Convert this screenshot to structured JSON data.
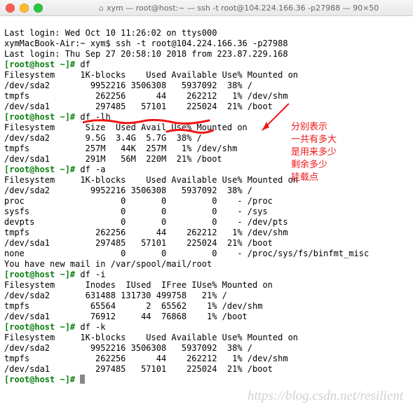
{
  "window": {
    "title": "xym — root@host:~ — ssh -t root@104.224.166.36 -p27988 — 90×50",
    "traffic": [
      "red",
      "yellow",
      "green"
    ],
    "home_icon": "⌂"
  },
  "lines": {
    "l0": "Last login: Wed Oct 10 11:26:02 on ttys000",
    "l1": "xymMacBook-Air:~ xym$ ssh -t root@104.224.166.36 -p27988",
    "l2": "Last login: Thu Sep 27 20:58:10 2018 from 223.87.229.168",
    "l3a": "[root@host ~]# ",
    "l3b": "df",
    "l4": "Filesystem     1K-blocks    Used Available Use% Mounted on",
    "l5": "/dev/sda2        9952216 3506308   5937092  38% /",
    "l6": "tmpfs             262256      44    262212   1% /dev/shm",
    "l7": "/dev/sda1         297485   57101    225024  21% /boot",
    "l8a": "[root@host ~]# ",
    "l8b": "df -lh",
    "l9": "Filesystem      Size  Used Avail Use% Mounted on",
    "l10": "/dev/sda2       9.5G  3.4G  5.7G  38% /",
    "l11": "tmpfs           257M   44K  257M   1% /dev/shm",
    "l12": "/dev/sda1       291M   56M  220M  21% /boot",
    "l13a": "[root@host ~]# ",
    "l13b": "df -a",
    "l14": "Filesystem     1K-blocks    Used Available Use% Mounted on",
    "l15": "/dev/sda2        9952216 3506308   5937092  38% /",
    "l16": "proc                   0       0         0    - /proc",
    "l17": "sysfs                  0       0         0    - /sys",
    "l18": "devpts                 0       0         0    - /dev/pts",
    "l19": "tmpfs             262256      44    262212   1% /dev/shm",
    "l20": "/dev/sda1         297485   57101    225024  21% /boot",
    "l21": "none                   0       0         0    - /proc/sys/fs/binfmt_misc",
    "l22": "You have new mail in /var/spool/mail/root",
    "l23a": "[root@host ~]# ",
    "l23b": "df -i",
    "l24": "Filesystem      Inodes  IUsed  IFree IUse% Mounted on",
    "l25": "/dev/sda2       631488 131730 499758   21% /",
    "l26": "tmpfs            65564      2  65562    1% /dev/shm",
    "l27": "/dev/sda1        76912     44  76868    1% /boot",
    "l28a": "[root@host ~]# ",
    "l28b": "df -k",
    "l29": "Filesystem     1K-blocks    Used Available Use% Mounted on",
    "l30": "/dev/sda2        9952216 3506308   5937092  38% /",
    "l31": "tmpfs             262256      44    262212   1% /dev/shm",
    "l32": "/dev/sda1         297485   57101    225024  21% /boot",
    "l33a": "[root@host ~]# "
  },
  "annotations": {
    "text1": "分别表示",
    "text2": "一共有多大",
    "text3": "是用来多少",
    "text4": "剩余多少",
    "text5": "挂载点"
  },
  "colors": {
    "annotation": "#f01616",
    "prompt_green": "#0b7f11"
  },
  "watermark": "https://blog.csdn.net/resilient",
  "chart_data": [
    {
      "type": "table",
      "title": "df",
      "columns": [
        "Filesystem",
        "1K-blocks",
        "Used",
        "Available",
        "Use%",
        "Mounted on"
      ],
      "rows": [
        [
          "/dev/sda2",
          9952216,
          3506308,
          5937092,
          "38%",
          "/"
        ],
        [
          "tmpfs",
          262256,
          44,
          262212,
          "1%",
          "/dev/shm"
        ],
        [
          "/dev/sda1",
          297485,
          57101,
          225024,
          "21%",
          "/boot"
        ]
      ]
    },
    {
      "type": "table",
      "title": "df -lh",
      "columns": [
        "Filesystem",
        "Size",
        "Used",
        "Avail",
        "Use%",
        "Mounted on"
      ],
      "rows": [
        [
          "/dev/sda2",
          "9.5G",
          "3.4G",
          "5.7G",
          "38%",
          "/"
        ],
        [
          "tmpfs",
          "257M",
          "44K",
          "257M",
          "1%",
          "/dev/shm"
        ],
        [
          "/dev/sda1",
          "291M",
          "56M",
          "220M",
          "21%",
          "/boot"
        ]
      ]
    },
    {
      "type": "table",
      "title": "df -a",
      "columns": [
        "Filesystem",
        "1K-blocks",
        "Used",
        "Available",
        "Use%",
        "Mounted on"
      ],
      "rows": [
        [
          "/dev/sda2",
          9952216,
          3506308,
          5937092,
          "38%",
          "/"
        ],
        [
          "proc",
          0,
          0,
          0,
          "-",
          "/proc"
        ],
        [
          "sysfs",
          0,
          0,
          0,
          "-",
          "/sys"
        ],
        [
          "devpts",
          0,
          0,
          0,
          "-",
          "/dev/pts"
        ],
        [
          "tmpfs",
          262256,
          44,
          262212,
          "1%",
          "/dev/shm"
        ],
        [
          "/dev/sda1",
          297485,
          57101,
          225024,
          "21%",
          "/boot"
        ],
        [
          "none",
          0,
          0,
          0,
          "-",
          "/proc/sys/fs/binfmt_misc"
        ]
      ]
    },
    {
      "type": "table",
      "title": "df -i",
      "columns": [
        "Filesystem",
        "Inodes",
        "IUsed",
        "IFree",
        "IUse%",
        "Mounted on"
      ],
      "rows": [
        [
          "/dev/sda2",
          631488,
          131730,
          499758,
          "21%",
          "/"
        ],
        [
          "tmpfs",
          65564,
          2,
          65562,
          "1%",
          "/dev/shm"
        ],
        [
          "/dev/sda1",
          76912,
          44,
          76868,
          "1%",
          "/boot"
        ]
      ]
    },
    {
      "type": "table",
      "title": "df -k",
      "columns": [
        "Filesystem",
        "1K-blocks",
        "Used",
        "Available",
        "Use%",
        "Mounted on"
      ],
      "rows": [
        [
          "/dev/sda2",
          9952216,
          3506308,
          5937092,
          "38%",
          "/"
        ],
        [
          "tmpfs",
          262256,
          44,
          262212,
          "1%",
          "/dev/shm"
        ],
        [
          "/dev/sda1",
          297485,
          57101,
          225024,
          "21%",
          "/boot"
        ]
      ]
    }
  ]
}
